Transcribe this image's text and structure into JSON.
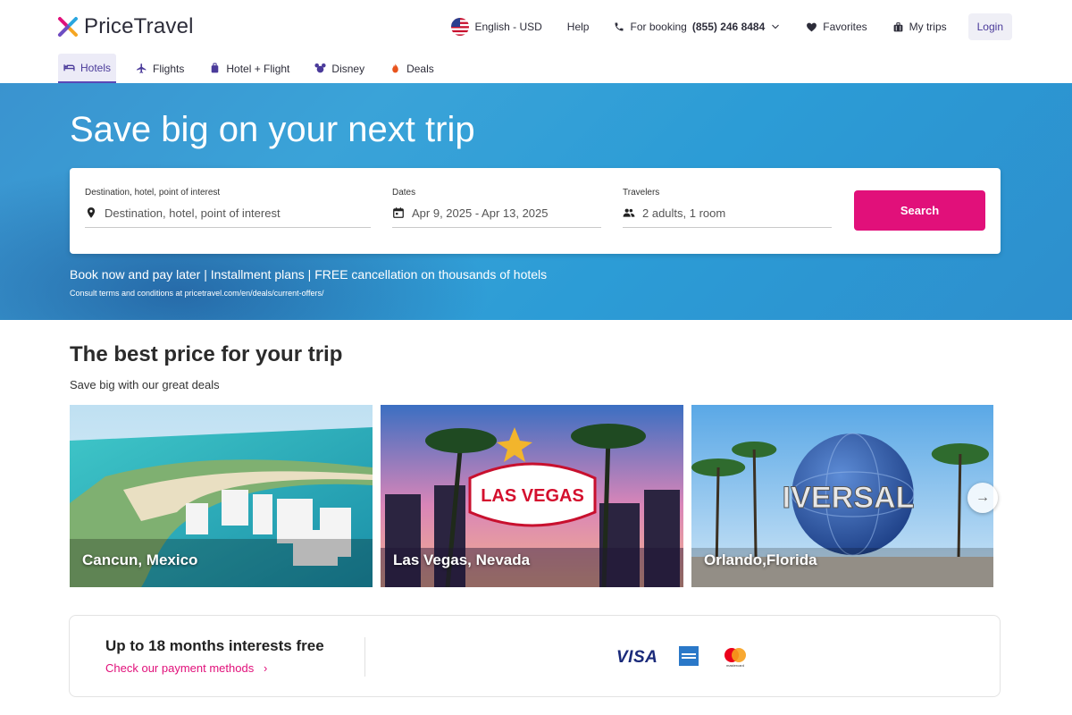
{
  "brand": {
    "name": "PriceTravel"
  },
  "topnav": {
    "language": "English - USD",
    "help": "Help",
    "booking_label": "For booking",
    "booking_phone": "(855) 246 8484",
    "favorites": "Favorites",
    "my_trips": "My trips",
    "login": "Login"
  },
  "tabs": [
    {
      "label": "Hotels",
      "icon": "bed-icon",
      "active": true
    },
    {
      "label": "Flights",
      "icon": "plane-icon"
    },
    {
      "label": "Hotel + Flight",
      "icon": "suitcase-icon"
    },
    {
      "label": "Disney",
      "icon": "mickey-icon"
    },
    {
      "label": "Deals",
      "icon": "flame-icon"
    }
  ],
  "hero": {
    "title": "Save big on your next trip",
    "note": "Book now and pay later | Installment plans | FREE cancellation on thousands of hotels",
    "terms": "Consult terms and conditions at pricetravel.com/en/deals/current-offers/"
  },
  "search": {
    "destination_label": "Destination, hotel, point of interest",
    "destination_placeholder": "Destination, hotel, point of interest",
    "dates_label": "Dates",
    "dates_value": "Apr 9, 2025 - Apr 13, 2025",
    "travelers_label": "Travelers",
    "travelers_value": "2 adults, 1 room",
    "button": "Search"
  },
  "deals": {
    "title": "The best price for your trip",
    "subtitle": "Save big with our great deals",
    "cards": [
      {
        "caption": "Cancun, Mexico"
      },
      {
        "caption": "Las Vegas, Nevada"
      },
      {
        "caption": "Orlando,Florida"
      }
    ]
  },
  "payments": {
    "title": "Up to 18 months interests free",
    "link": "Check our payment methods",
    "visa": "VISA",
    "mastercard": "mastercard"
  },
  "colors": {
    "accent": "#e1107a",
    "brand_purple": "#5a48b6",
    "hero_blue": "#2c9cd6"
  }
}
